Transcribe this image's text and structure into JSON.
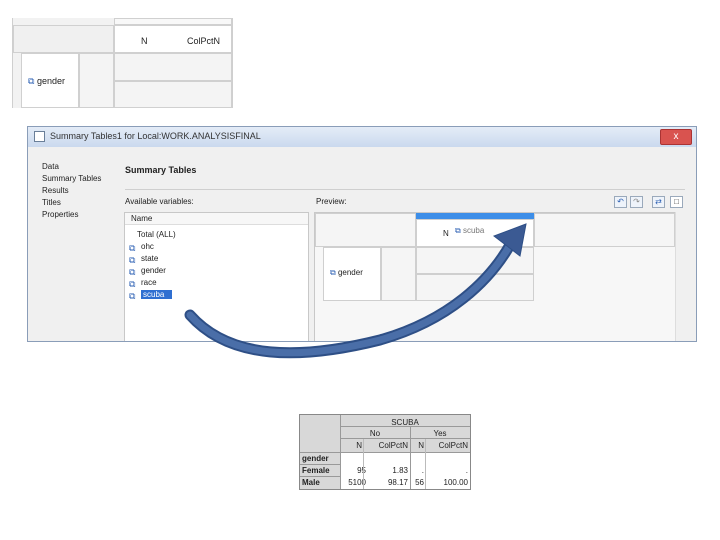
{
  "top_preview": {
    "col_n": "N",
    "col_colpctn": "ColPctN",
    "row_var": "gender"
  },
  "window": {
    "title": "Summary Tables1 for Local:WORK.ANALYSISFINAL",
    "close_label": "x"
  },
  "nav": {
    "items": [
      "Data",
      "Summary Tables",
      "Results",
      "Titles",
      "Properties"
    ]
  },
  "main": {
    "page_title": "Summary Tables",
    "available_label": "Available variables:",
    "preview_label": "Preview:",
    "list_header": "Name",
    "variables": [
      {
        "label": "Total (ALL)",
        "icon": "none"
      },
      {
        "label": "ohc",
        "icon": "variable-icon"
      },
      {
        "label": "state",
        "icon": "variable-icon"
      },
      {
        "label": "gender",
        "icon": "variable-icon"
      },
      {
        "label": "race",
        "icon": "variable-icon"
      },
      {
        "label": "scuba",
        "icon": "variable-icon",
        "selected": true
      }
    ],
    "preview": {
      "col_n": "N",
      "col_var": "scuba",
      "row_var": "gender"
    }
  },
  "output_table": {
    "title": "SCUBA",
    "groups": [
      "No",
      "Yes"
    ],
    "col_headers": [
      "N",
      "ColPctN",
      "N",
      "ColPctN"
    ],
    "row_var": "gender",
    "rows": [
      {
        "label": "Female",
        "values": [
          "95",
          "1.83",
          ".",
          "."
        ]
      },
      {
        "label": "Male",
        "values": [
          "5100",
          "98.17",
          "56",
          "100.00"
        ]
      }
    ]
  },
  "colors": {
    "accent_blue": "#2f6fd1",
    "arrow": "#3b5a93"
  }
}
